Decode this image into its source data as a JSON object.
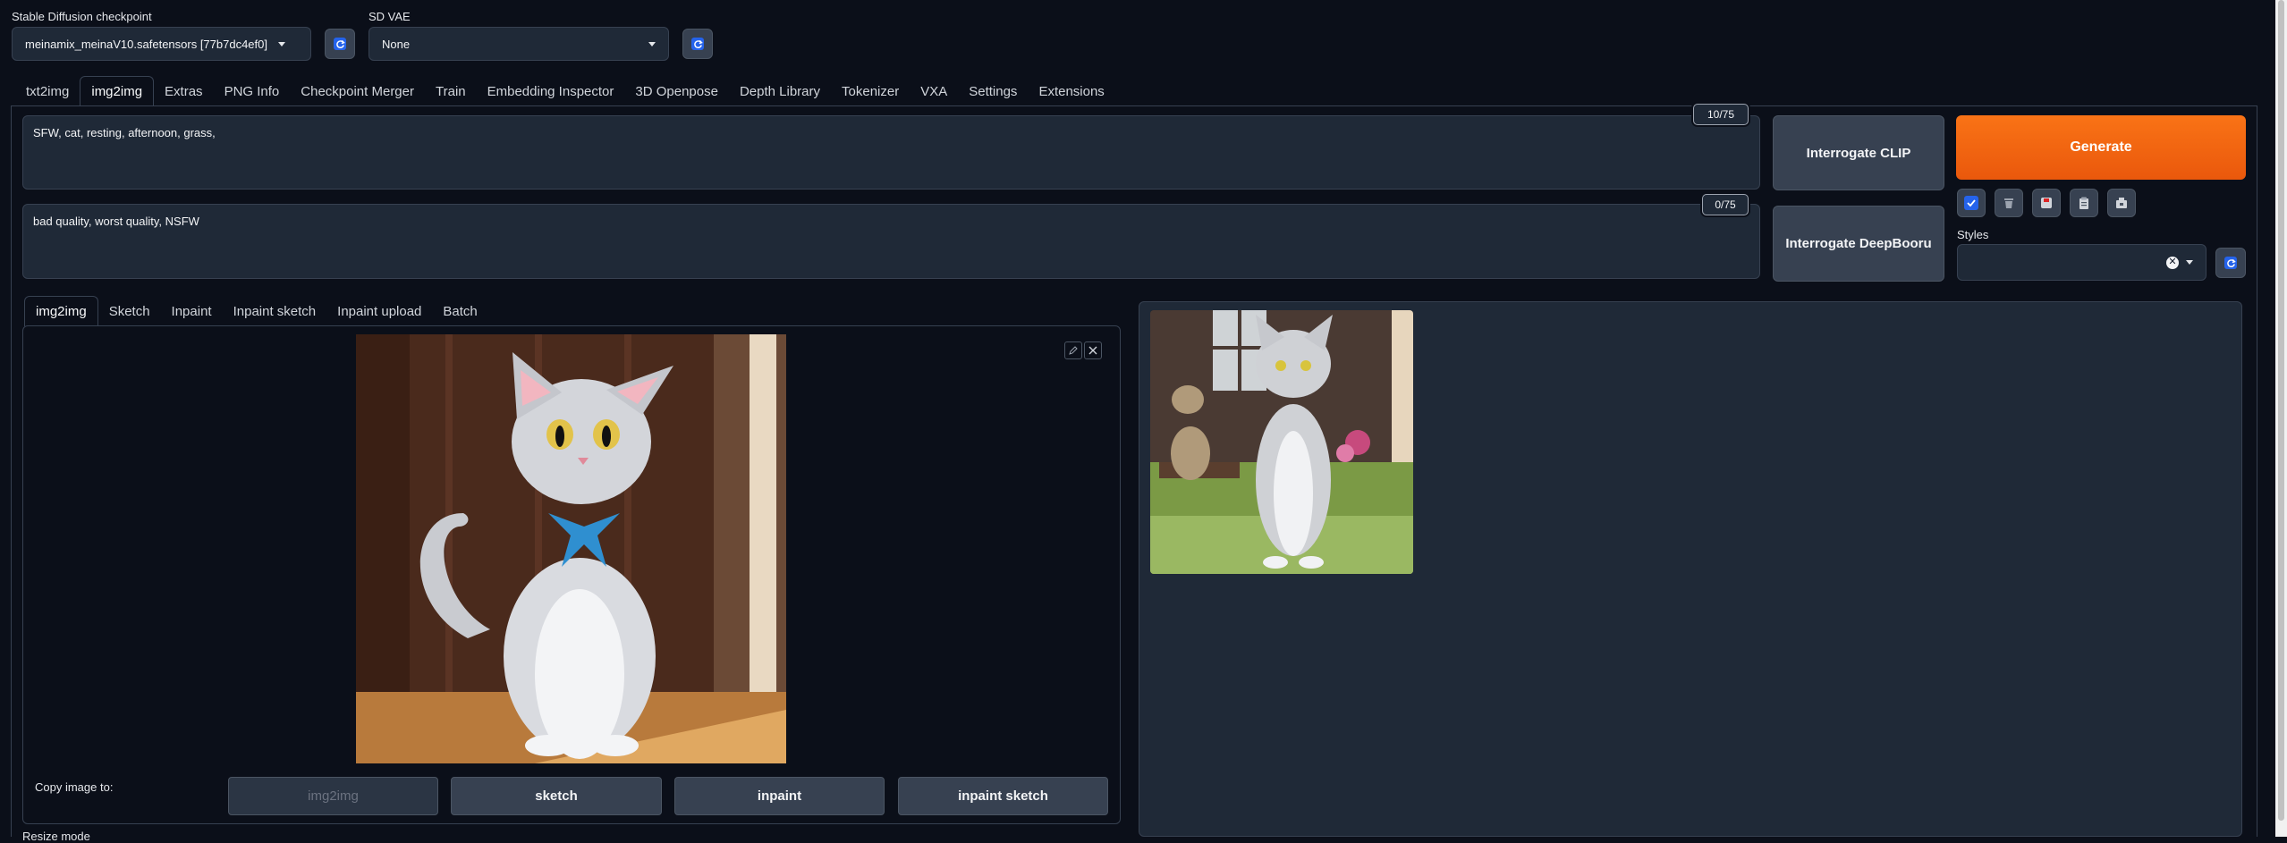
{
  "checkpoint": {
    "label": "Stable Diffusion checkpoint",
    "value": "meinamix_meinaV10.safetensors [77b7dc4ef0]"
  },
  "vae": {
    "label": "SD VAE",
    "value": "None"
  },
  "main_tabs": [
    {
      "label": "txt2img"
    },
    {
      "label": "img2img",
      "active": true
    },
    {
      "label": "Extras"
    },
    {
      "label": "PNG Info"
    },
    {
      "label": "Checkpoint Merger"
    },
    {
      "label": "Train"
    },
    {
      "label": "Embedding Inspector"
    },
    {
      "label": "3D Openpose"
    },
    {
      "label": "Depth Library"
    },
    {
      "label": "Tokenizer"
    },
    {
      "label": "VXA"
    },
    {
      "label": "Settings"
    },
    {
      "label": "Extensions"
    }
  ],
  "prompt": {
    "positive": "SFW, cat, resting, afternoon, grass,",
    "positive_count": "10/75",
    "negative": "bad quality, worst quality, NSFW",
    "negative_count": "0/75"
  },
  "buttons": {
    "interrogate_clip": "Interrogate CLIP",
    "interrogate_deepbooru": "Interrogate DeepBooru",
    "generate": "Generate"
  },
  "styles": {
    "label": "Styles",
    "value": ""
  },
  "sub_tabs": [
    {
      "label": "img2img",
      "active": true
    },
    {
      "label": "Sketch"
    },
    {
      "label": "Inpaint"
    },
    {
      "label": "Inpaint sketch"
    },
    {
      "label": "Inpaint upload"
    },
    {
      "label": "Batch"
    }
  ],
  "copy_image": {
    "label": "Copy image to:",
    "buttons": [
      {
        "label": "img2img",
        "disabled": true
      },
      {
        "label": "sketch"
      },
      {
        "label": "inpaint"
      },
      {
        "label": "inpaint sketch"
      }
    ]
  },
  "resize_mode": {
    "label": "Resize mode"
  },
  "colors": {
    "background": "#0b0f19",
    "panel": "#1f2937",
    "accent_orange": "#f97316",
    "accent_blue": "#2563eb"
  },
  "icons": [
    "refresh-icon",
    "checkbox-icon",
    "trash-icon",
    "save-style-icon",
    "clipboard-icon",
    "apply-style-icon",
    "pencil-icon",
    "close-icon",
    "clear-icon",
    "chevron-down-icon"
  ]
}
